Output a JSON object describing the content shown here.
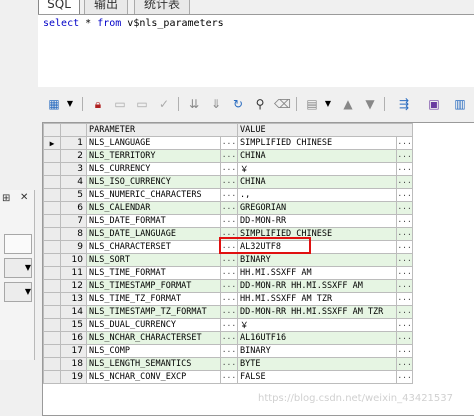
{
  "tabs": [
    "SQL",
    "输出",
    "统计表"
  ],
  "editor": {
    "kw1": "select",
    "star": " * ",
    "kw2": "from",
    "rest": " v$nls_parameters"
  },
  "toolbar_icons": [
    "grid-menu-icon",
    "lock-icon",
    "insert-row-icon",
    "delete-row-icon",
    "post-changes-icon",
    "first-record-icon",
    "next-record-icon",
    "refresh-icon",
    "find-icon",
    "clear-icon",
    "filter-icon",
    "sort-icon",
    "export-icon",
    "save-icon"
  ],
  "grid": {
    "columns": [
      "PARAMETER",
      "VALUE"
    ],
    "rows": [
      {
        "n": "1",
        "p": "NLS_LANGUAGE",
        "v": "SIMPLIFIED CHINESE"
      },
      {
        "n": "2",
        "p": "NLS_TERRITORY",
        "v": "CHINA"
      },
      {
        "n": "3",
        "p": "NLS_CURRENCY",
        "v": "￥"
      },
      {
        "n": "4",
        "p": "NLS_ISO_CURRENCY",
        "v": "CHINA"
      },
      {
        "n": "5",
        "p": "NLS_NUMERIC_CHARACTERS",
        "v": ".,"
      },
      {
        "n": "6",
        "p": "NLS_CALENDAR",
        "v": "GREGORIAN"
      },
      {
        "n": "7",
        "p": "NLS_DATE_FORMAT",
        "v": "DD-MON-RR"
      },
      {
        "n": "8",
        "p": "NLS_DATE_LANGUAGE",
        "v": "SIMPLIFIED CHINESE"
      },
      {
        "n": "9",
        "p": "NLS_CHARACTERSET",
        "v": "AL32UTF8"
      },
      {
        "n": "10",
        "p": "NLS_SORT",
        "v": "BINARY"
      },
      {
        "n": "11",
        "p": "NLS_TIME_FORMAT",
        "v": "HH.MI.SSXFF AM"
      },
      {
        "n": "12",
        "p": "NLS_TIMESTAMP_FORMAT",
        "v": "DD-MON-RR HH.MI.SSXFF AM"
      },
      {
        "n": "13",
        "p": "NLS_TIME_TZ_FORMAT",
        "v": "HH.MI.SSXFF AM TZR"
      },
      {
        "n": "14",
        "p": "NLS_TIMESTAMP_TZ_FORMAT",
        "v": "DD-MON-RR HH.MI.SSXFF AM TZR"
      },
      {
        "n": "15",
        "p": "NLS_DUAL_CURRENCY",
        "v": "￥"
      },
      {
        "n": "16",
        "p": "NLS_NCHAR_CHARACTERSET",
        "v": "AL16UTF16"
      },
      {
        "n": "17",
        "p": "NLS_COMP",
        "v": "BINARY"
      },
      {
        "n": "18",
        "p": "NLS_LENGTH_SEMANTICS",
        "v": "BYTE"
      },
      {
        "n": "19",
        "p": "NLS_NCHAR_CONV_EXCP",
        "v": "FALSE"
      }
    ]
  },
  "cell_button": "···",
  "current_row_marker": "▶",
  "watermark": "https://blog.csdn.net/weixin_43421537",
  "colors": {
    "highlight": "#e01010",
    "row_even": "#e6f5e3",
    "keyword": "#0000c8"
  }
}
